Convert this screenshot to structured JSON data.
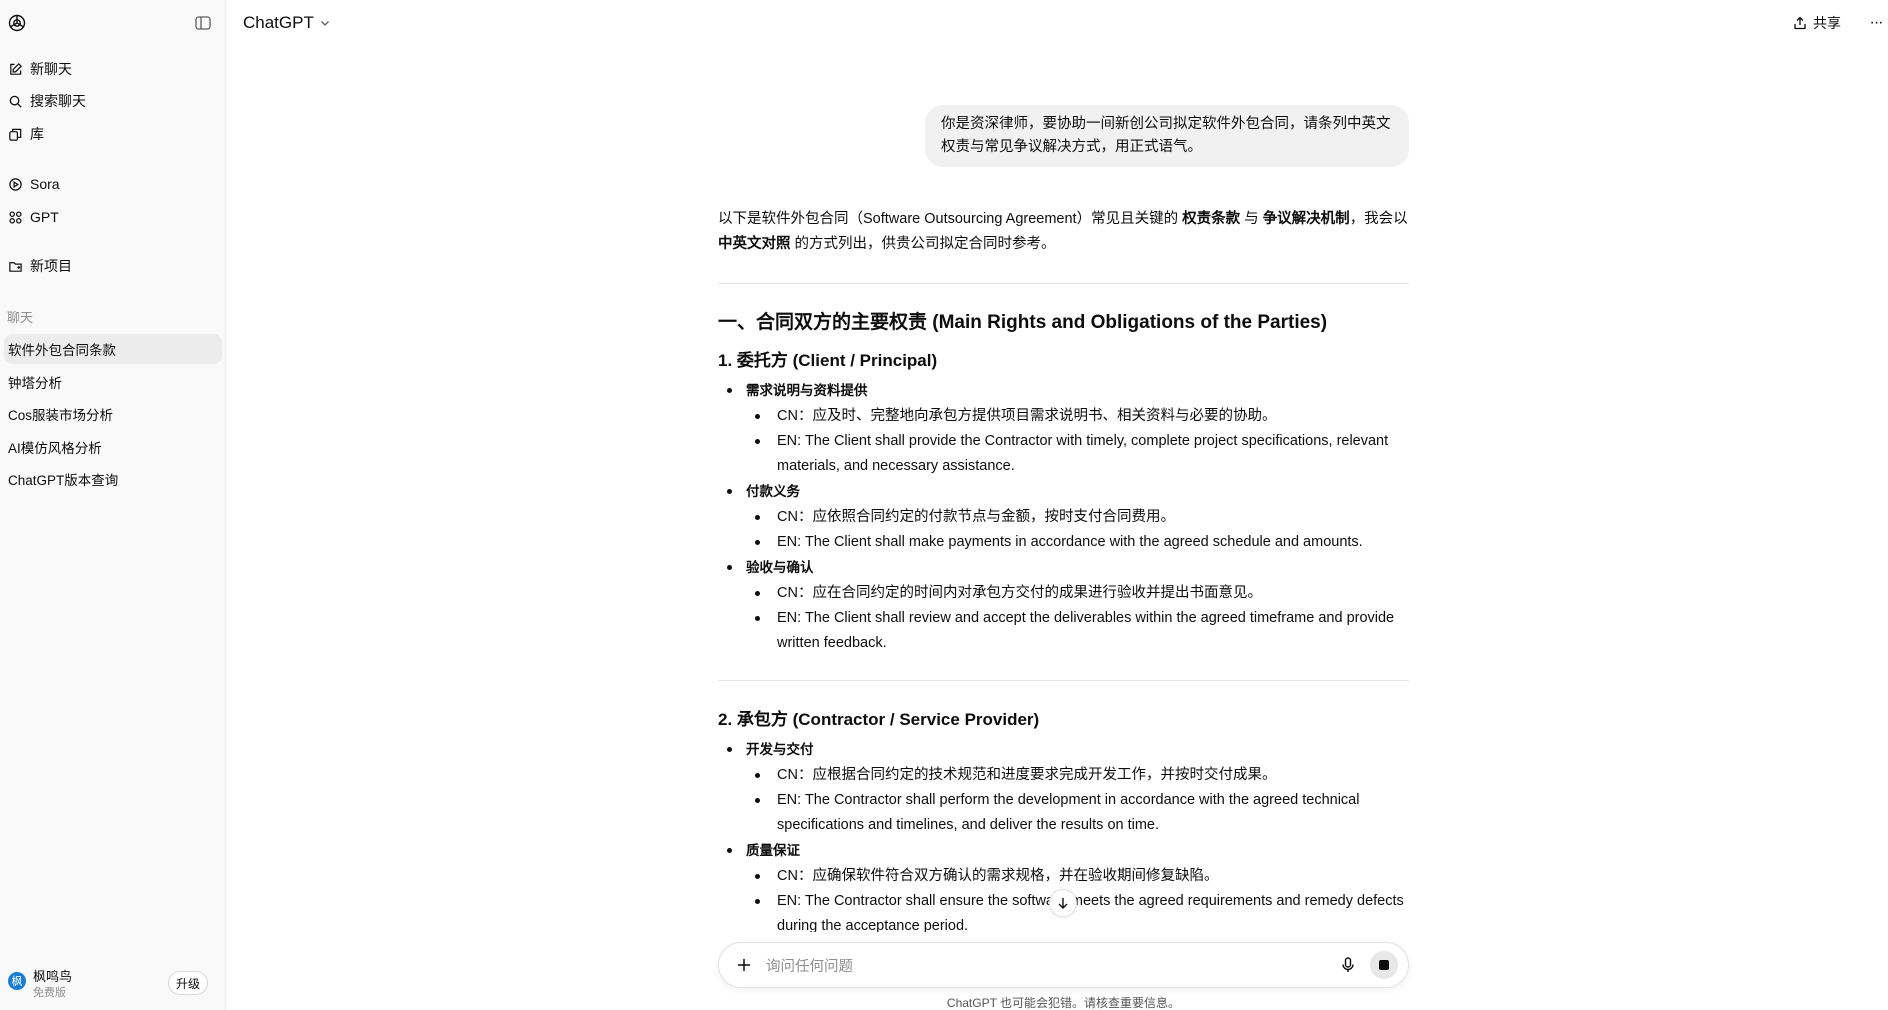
{
  "header": {
    "model_label": "ChatGPT",
    "share_label": "共享",
    "more_label": "···"
  },
  "sidebar": {
    "nav": [
      {
        "label": "新聊天",
        "icon": "edit-icon"
      },
      {
        "label": "搜索聊天",
        "icon": "search-icon"
      },
      {
        "label": "库",
        "icon": "library-icon"
      },
      {
        "label": "Sora",
        "icon": "play-circle-icon"
      },
      {
        "label": "GPT",
        "icon": "grid-icon"
      },
      {
        "label": "新项目",
        "icon": "folder-plus-icon"
      }
    ],
    "section_label": "聊天",
    "chats": [
      {
        "label": "软件外包合同条款",
        "active": true
      },
      {
        "label": "钟塔分析",
        "active": false
      },
      {
        "label": "Cos服装市场分析",
        "active": false
      },
      {
        "label": "AI模仿风格分析",
        "active": false
      },
      {
        "label": "ChatGPT版本查询",
        "active": false
      }
    ],
    "user": {
      "avatar": "枫",
      "name": "枫鸣鸟",
      "plan": "免费版",
      "upgrade_label": "升级"
    }
  },
  "conversation": {
    "user_message": "你是资深律师，要协助一间新创公司拟定软件外包合同，请条列中英文权责与常见争议解决方式，用正式语气。",
    "intro": [
      {
        "text": "以下是软件外包合同（Software Outsourcing Agreement）常见且关键的 ",
        "bold": false
      },
      {
        "text": "权责条款",
        "bold": true
      },
      {
        "text": " 与 ",
        "bold": false
      },
      {
        "text": "争议解决机制",
        "bold": true
      },
      {
        "text": "，我会以 ",
        "bold": false
      },
      {
        "text": "中英文对照",
        "bold": true
      },
      {
        "text": " 的方式列出，供贵公司拟定合同时参考。",
        "bold": false
      }
    ],
    "section1_title": "一、合同双方的主要权责 (Main Rights and Obligations of the Parties)",
    "parties": [
      {
        "title": "1. 委托方 (Client / Principal)",
        "items": [
          {
            "label": "需求说明与资料提供",
            "points": [
              "CN：应及时、完整地向承包方提供项目需求说明书、相关资料与必要的协助。",
              "EN: The Client shall provide the Contractor with timely, complete project specifications, relevant materials, and necessary assistance."
            ]
          },
          {
            "label": "付款义务",
            "points": [
              "CN：应依照合同约定的付款节点与金额，按时支付合同费用。",
              "EN: The Client shall make payments in accordance with the agreed schedule and amounts."
            ]
          },
          {
            "label": "验收与确认",
            "points": [
              "CN：应在合同约定的时间内对承包方交付的成果进行验收并提出书面意见。",
              "EN: The Client shall review and accept the deliverables within the agreed timeframe and provide written feedback."
            ]
          }
        ]
      },
      {
        "title": "2. 承包方 (Contractor / Service Provider)",
        "items": [
          {
            "label": "开发与交付",
            "points": [
              "CN：应根据合同约定的技术规范和进度要求完成开发工作，并按时交付成果。",
              "EN: The Contractor shall perform the development in accordance with the agreed technical specifications and timelines, and deliver the results on time."
            ]
          },
          {
            "label": "质量保证",
            "points": [
              "CN：应确保软件符合双方确认的需求规格，并在验收期间修复缺陷。",
              "EN: The Contractor shall ensure the software meets the agreed requirements and remedy defects during the acceptance period."
            ]
          }
        ]
      }
    ]
  },
  "composer": {
    "placeholder": "询问任何问题"
  },
  "footer": {
    "disclaimer": "ChatGPT 也可能会犯错。请核查重要信息。"
  }
}
